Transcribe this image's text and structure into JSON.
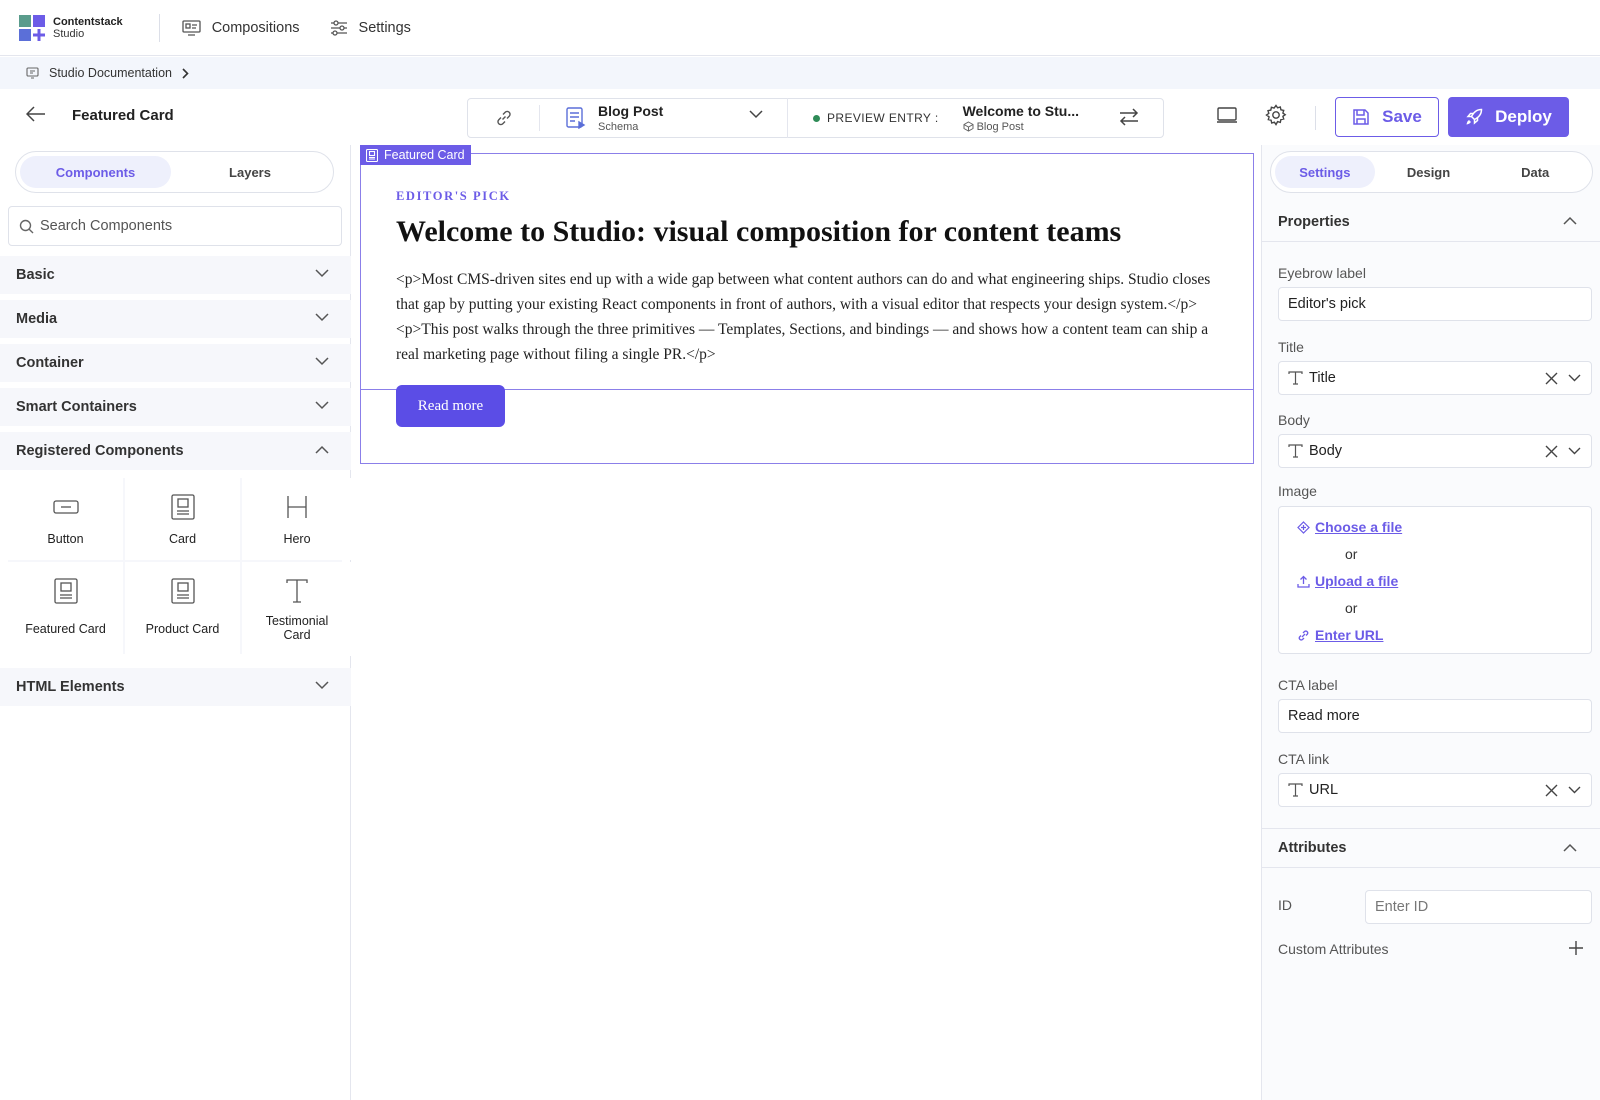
{
  "app": {
    "logo_title": "Contentstack",
    "logo_subtitle": "Studio",
    "nav": [
      {
        "label": "Compositions",
        "icon": "compositions-icon"
      },
      {
        "label": "Settings",
        "icon": "sliders-icon"
      }
    ]
  },
  "breadcrumb": {
    "label": "Studio Documentation",
    "icon": "docs-icon"
  },
  "toolbar": {
    "title": "Featured Card",
    "schema_title": "Blog Post",
    "schema_sub": "Schema",
    "preview_label": "PREVIEW ENTRY :",
    "entry_title": "Welcome to Stu...",
    "entry_sub": "Blog Post",
    "save_label": "Save",
    "deploy_label": "Deploy"
  },
  "left": {
    "tabs": [
      "Components",
      "Layers"
    ],
    "search_placeholder": "Search Components",
    "categories": [
      "Basic",
      "Media",
      "Container",
      "Smart Containers",
      "Registered Components",
      "HTML Elements"
    ],
    "registered": [
      {
        "label": "Button",
        "icon": "button-icon"
      },
      {
        "label": "Card",
        "icon": "card-icon"
      },
      {
        "label": "Hero",
        "icon": "hero-icon"
      },
      {
        "label": "Featured Card",
        "icon": "card-icon"
      },
      {
        "label": "Product Card",
        "icon": "card-icon"
      },
      {
        "label": "Testimonial Card",
        "icon": "text-icon"
      }
    ]
  },
  "canvas": {
    "component_label": "Featured Card",
    "eyebrow": "EDITOR'S PICK",
    "headline": "Welcome to Studio: visual composition for content teams",
    "body": "<p>Most CMS-driven sites end up with a wide gap between what content authors can do and what engineering ships. Studio closes that gap by putting your existing React components in front of authors, with a visual editor that respects your design system.</p><p>This post walks through the three primitives — Templates, Sections, and bindings — and shows how a content team can ship a real marketing page without filing a single PR.</p>",
    "cta": "Read more"
  },
  "right": {
    "tabs": [
      "Settings",
      "Design",
      "Data"
    ],
    "properties_title": "Properties",
    "fields": {
      "eyebrow_label": "Eyebrow label",
      "eyebrow_value": "Editor's pick",
      "title_label": "Title",
      "title_value": "Title",
      "body_label": "Body",
      "body_value": "Body",
      "image_label": "Image",
      "choose_file": "Choose a file",
      "or1": "or",
      "upload_file": "Upload a file",
      "or2": "or",
      "enter_url": "Enter URL",
      "cta_label_label": "CTA label",
      "cta_label_value": "Read more",
      "cta_link_label": "CTA link",
      "cta_link_value": "URL"
    },
    "attributes_title": "Attributes",
    "id_label": "ID",
    "id_placeholder": "Enter ID",
    "custom_attributes": "Custom Attributes"
  },
  "colors": {
    "accent": "#6c5ce7",
    "status_dot": "#2e8b57"
  }
}
